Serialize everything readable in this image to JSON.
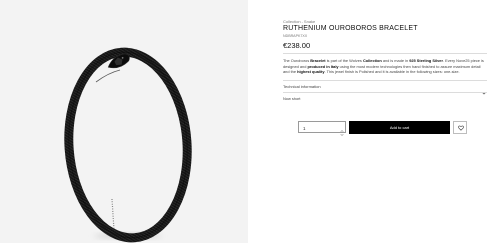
{
  "breadcrumb": [
    "Collection",
    "Snake"
  ],
  "product": {
    "title": "RUTHENIUM OUROBOROS BRACELET",
    "sku": "NDBRAPK7XX",
    "price": "€238.00",
    "description": {
      "p1": "The Ouroboros ",
      "b1": "Bracelet",
      "p2": " is part of the Wolves ",
      "b2": "Collection",
      "p3": " and is made in ",
      "b3": "925 Sterling Silver",
      "p4": ". Every Nove25 piece is designed and ",
      "b4": "produced in Italy",
      "p5": " using the most modern technologies then hand finished to assure maximum detail and the ",
      "b5": "highest quality",
      "p6": ". This jewel finish is Polished and it is available in the following sizes: one-size."
    },
    "technical_label": "Technical information",
    "stock_status": "Now short"
  },
  "cart": {
    "quantity": "1",
    "add_label": "Add to cart"
  },
  "icons": {
    "chevron": "chevron-down-icon",
    "wishlist": "heart-icon",
    "spinner": "stepper-arrows-icon"
  },
  "colors": {
    "button_bg": "#000000",
    "image_bg": "#f3f3f3",
    "bracelet": "#111111"
  }
}
